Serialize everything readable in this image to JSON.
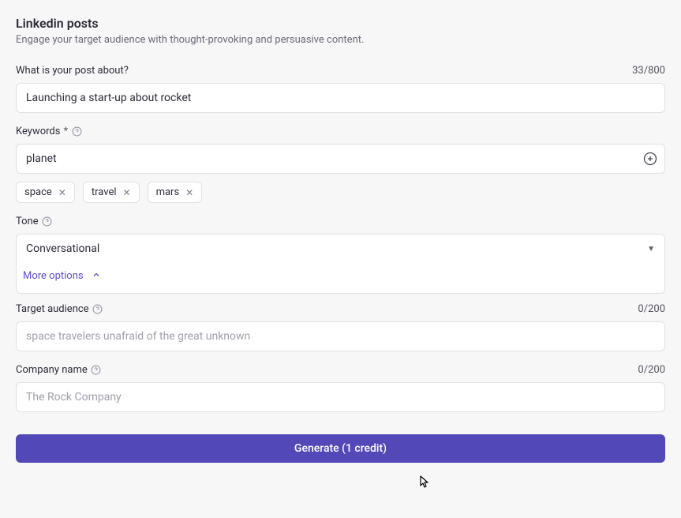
{
  "header": {
    "title": "Linkedin posts",
    "subtitle": "Engage your target audience with thought-provoking and persuasive content."
  },
  "fields": {
    "post_about": {
      "label": "What is your post about?",
      "value": "Launching a start-up about rocket",
      "counter": "33/800"
    },
    "keywords": {
      "label": "Keywords",
      "required": "*",
      "value": "planet",
      "tags": [
        "space",
        "travel",
        "mars"
      ]
    },
    "tone": {
      "label": "Tone",
      "value": "Conversational"
    },
    "more_options_label": "More options",
    "target_audience": {
      "label": "Target audience",
      "placeholder": "space travelers unafraid of the great unknown",
      "value": "",
      "counter": "0/200"
    },
    "company_name": {
      "label": "Company name",
      "placeholder": "The Rock Company",
      "value": "",
      "counter": "0/200"
    }
  },
  "actions": {
    "generate_label": "Generate (1 credit)"
  }
}
